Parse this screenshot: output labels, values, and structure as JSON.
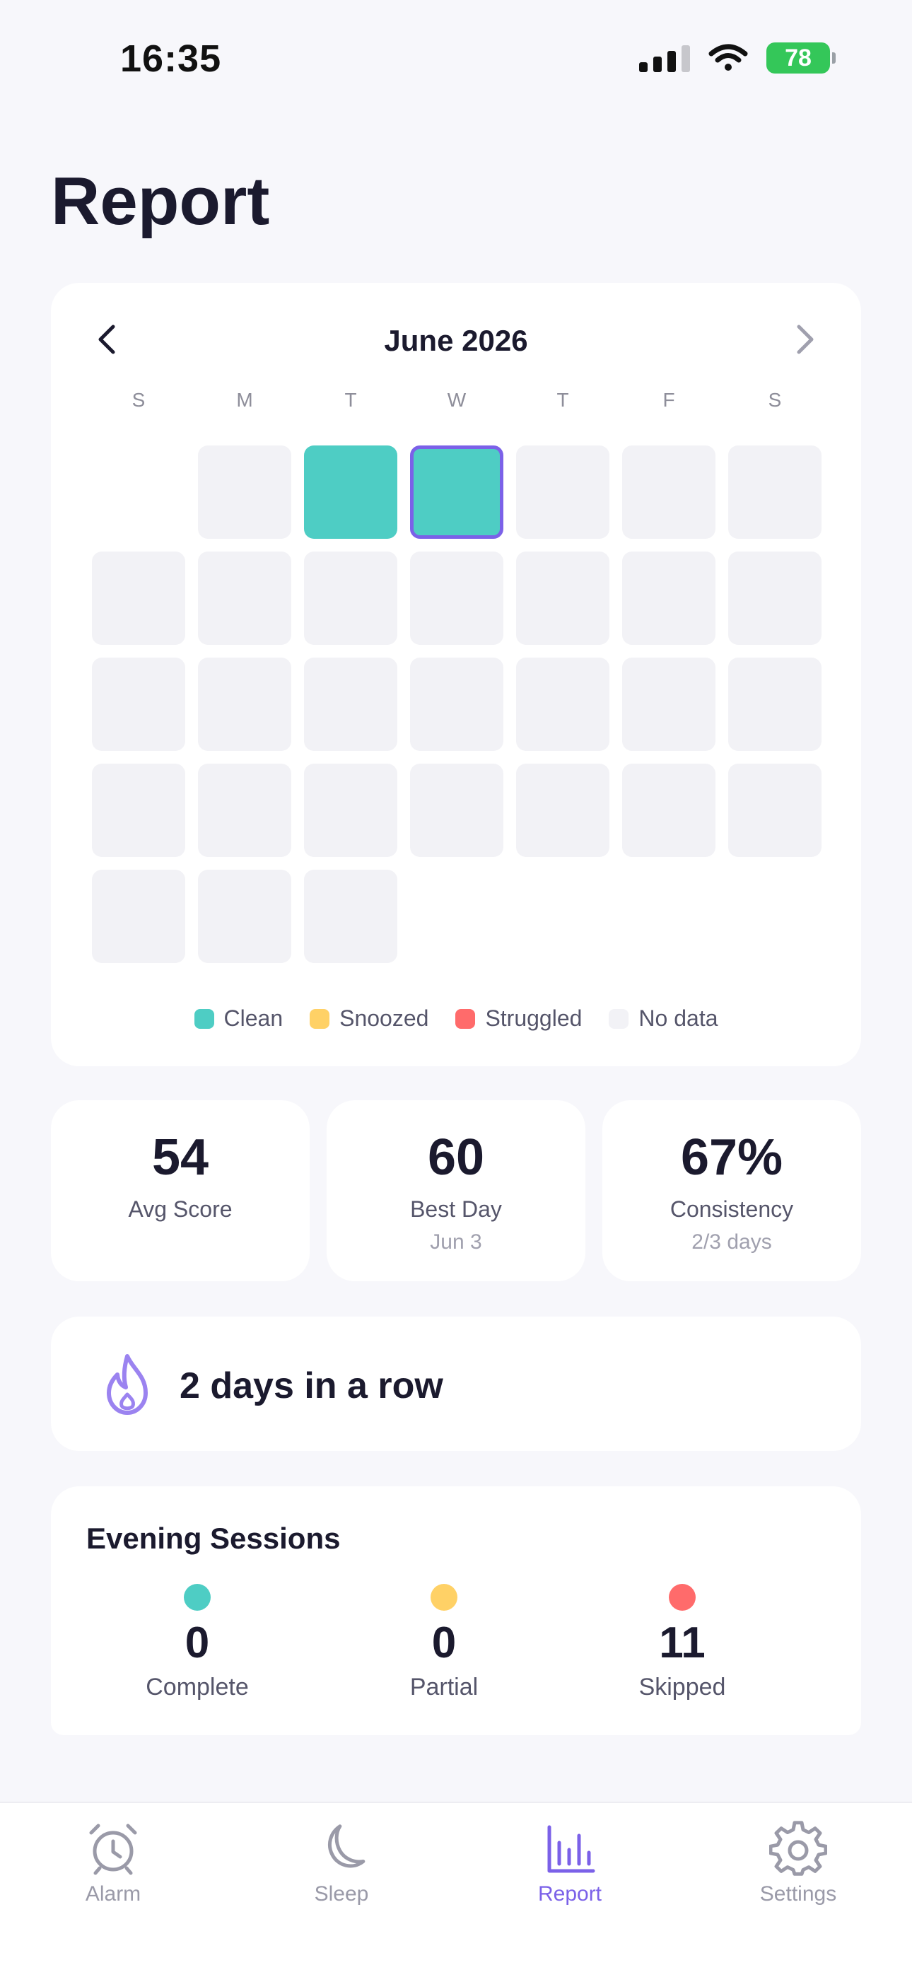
{
  "status_bar": {
    "time": "16:35",
    "battery": "78"
  },
  "page": {
    "title": "Report"
  },
  "calendar": {
    "month": "June 2026",
    "weekdays": [
      "S",
      "M",
      "T",
      "W",
      "T",
      "F",
      "S"
    ],
    "legend": [
      {
        "label": "Clean",
        "color": "#4ECDC4"
      },
      {
        "label": "Snoozed",
        "color": "#FFD166"
      },
      {
        "label": "Struggled",
        "color": "#FF6B6B"
      },
      {
        "label": "No data",
        "color": "#F2F2F6"
      }
    ]
  },
  "stats": [
    {
      "value": "54",
      "label": "Avg Score",
      "sub": ""
    },
    {
      "value": "60",
      "label": "Best Day",
      "sub": "Jun 3"
    },
    {
      "value": "67%",
      "label": "Consistency",
      "sub": "2/3 days"
    }
  ],
  "streak": {
    "text": "2 days in a row"
  },
  "sessions": {
    "title": "Evening Sessions",
    "items": [
      {
        "value": "0",
        "label": "Complete",
        "color": "#4ECDC4"
      },
      {
        "value": "0",
        "label": "Partial",
        "color": "#FFD166"
      },
      {
        "value": "11",
        "label": "Skipped",
        "color": "#FF6B6B"
      }
    ]
  },
  "tabs": [
    {
      "label": "Alarm",
      "icon": "alarm-clock-icon"
    },
    {
      "label": "Sleep",
      "icon": "moon-icon"
    },
    {
      "label": "Report",
      "icon": "bar-chart-icon",
      "active": true
    },
    {
      "label": "Settings",
      "icon": "gear-icon"
    }
  ]
}
